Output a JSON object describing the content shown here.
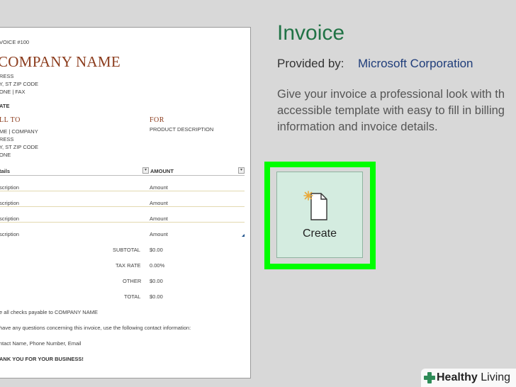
{
  "invoice_preview": {
    "invoice_number": "VOICE #100",
    "company_name": "COMPANY NAME",
    "address_line1": "RESS",
    "address_line2": "Y, ST ZIP CODE",
    "address_line3": "ONE | FAX",
    "date_label": "ATE",
    "bill_to_label": "LL TO",
    "bill_to_line1": "ME | COMPANY",
    "bill_to_line2": "RESS",
    "bill_to_line3": "Y, ST ZIP CODE",
    "bill_to_line4": "ONE",
    "for_label": "FOR",
    "for_value": "PRODUCT DESCRIPTION",
    "details_header": "tails",
    "amount_header": "AMOUNT",
    "rows": [
      {
        "desc": "scription",
        "amount": "Amount"
      },
      {
        "desc": "scription",
        "amount": "Amount"
      },
      {
        "desc": "scription",
        "amount": "Amount"
      },
      {
        "desc": "scription",
        "amount": "Amount"
      }
    ],
    "subtotal_label": "SUBTOTAL",
    "subtotal_value": "$0.00",
    "tax_label": "TAX RATE",
    "tax_value": "0.00%",
    "other_label": "OTHER",
    "other_value": "$0.00",
    "total_label": "TOTAL",
    "total_value": "$0.00",
    "note1": "e all checks payable to COMPANY NAME",
    "note2": "have any questions concerning this invoice, use the following contact information:",
    "note3": "ntact Name, Phone Number, Email",
    "note4": "ANK YOU FOR YOUR BUSINESS!"
  },
  "template": {
    "title": "Invoice",
    "provided_by_label": "Provided by:",
    "provided_by_value": "Microsoft Corporation",
    "description_lines": [
      "Give your invoice a professional look with th",
      "accessible template with easy to fill in billing",
      "information and invoice details."
    ],
    "create_label": "Create"
  },
  "watermark": {
    "brand_bold": "Healthy",
    "brand_rest": " Living"
  },
  "colors": {
    "title_green": "#217346",
    "highlight": "#00ff00",
    "link_blue": "#1f3d7a",
    "company_rust": "#8b3b1c"
  }
}
